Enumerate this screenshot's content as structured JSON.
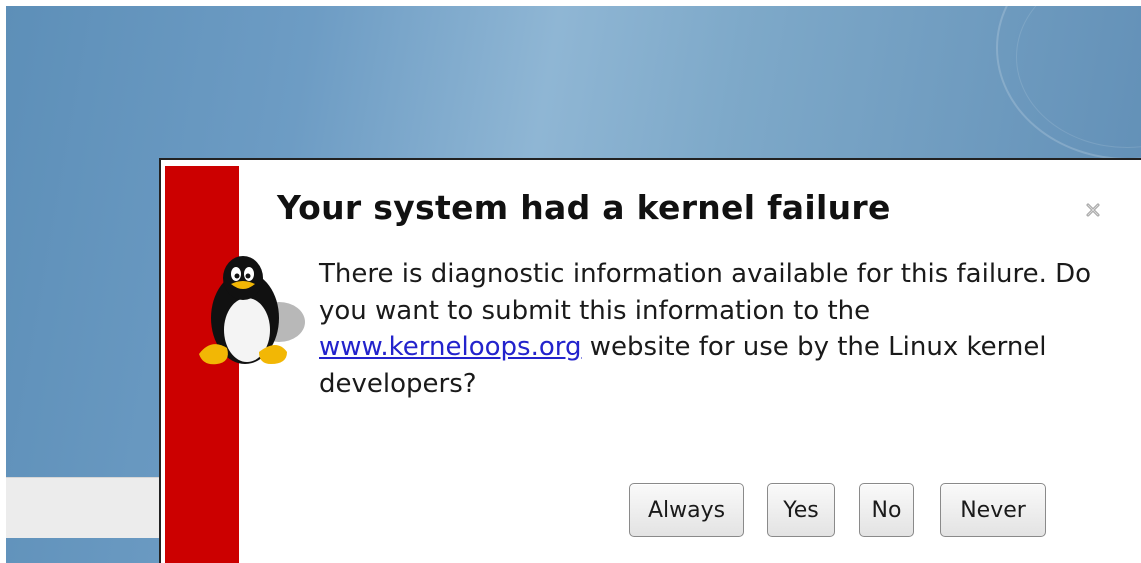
{
  "notification": {
    "title": "Your system had a kernel failure",
    "message_before_link": "There is diagnostic information available for this failure. Do you want to submit this information to the ",
    "link_text": "www.kerneloops.org",
    "message_after_link": " website for use by the Linux kernel developers?",
    "icon": "tux-penguin-icon",
    "close_icon": "close-icon",
    "urgency_color": "#cc0000"
  },
  "actions": {
    "always_label": "Always",
    "yes_label": "Yes",
    "no_label": "No",
    "never_label": "Never"
  }
}
